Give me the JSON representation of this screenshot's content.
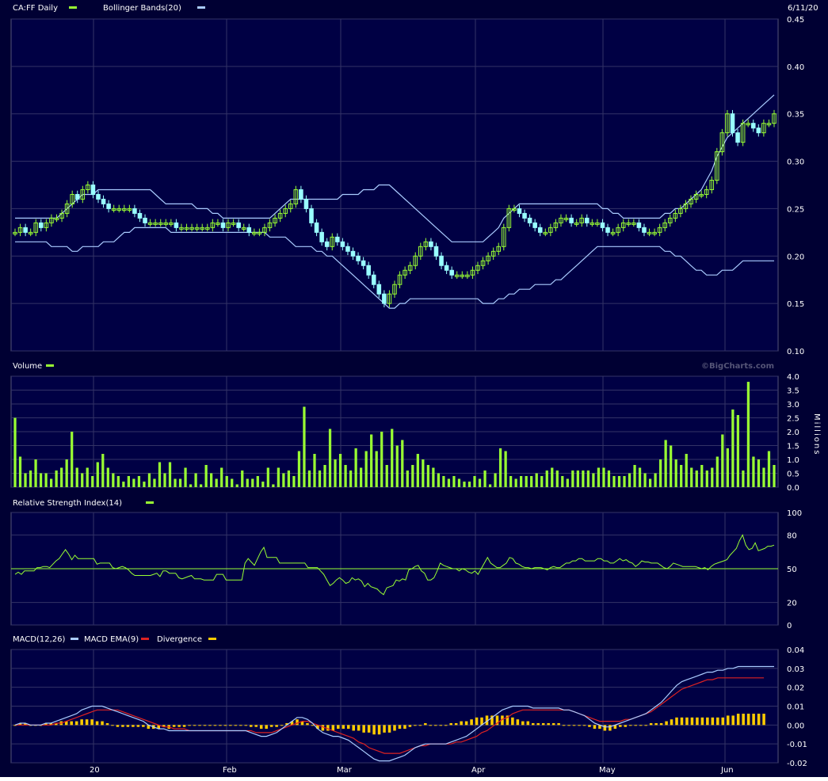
{
  "chart_data": [
    {
      "type": "candlestick",
      "title": "CA:FF Daily",
      "date_label": "6/11/20",
      "overlay_label": "Bollinger Bands(20)",
      "colors": {
        "up": "#99ff33",
        "down": "#99ffff",
        "upper_band": "#aaccff",
        "lower_band": "#aaccff"
      },
      "ylim": [
        0.1,
        0.45
      ],
      "y_ticks": [
        "0.45",
        "0.40",
        "0.35",
        "0.30",
        "0.25",
        "0.20",
        "0.15",
        "0.10"
      ],
      "x_ticks": [
        "20",
        "Feb",
        "Mar",
        "Apr",
        "May",
        "Jun"
      ],
      "close": [
        0.225,
        0.23,
        0.225,
        0.225,
        0.235,
        0.23,
        0.235,
        0.24,
        0.24,
        0.245,
        0.255,
        0.265,
        0.26,
        0.27,
        0.275,
        0.265,
        0.26,
        0.255,
        0.25,
        0.25,
        0.25,
        0.25,
        0.25,
        0.245,
        0.24,
        0.235,
        0.235,
        0.235,
        0.235,
        0.235,
        0.235,
        0.23,
        0.23,
        0.23,
        0.23,
        0.23,
        0.23,
        0.23,
        0.235,
        0.235,
        0.23,
        0.235,
        0.235,
        0.23,
        0.23,
        0.225,
        0.225,
        0.225,
        0.23,
        0.235,
        0.24,
        0.245,
        0.25,
        0.255,
        0.27,
        0.26,
        0.25,
        0.235,
        0.225,
        0.215,
        0.21,
        0.22,
        0.215,
        0.21,
        0.205,
        0.2,
        0.195,
        0.19,
        0.18,
        0.17,
        0.16,
        0.15,
        0.16,
        0.17,
        0.18,
        0.185,
        0.19,
        0.2,
        0.21,
        0.215,
        0.21,
        0.2,
        0.19,
        0.185,
        0.18,
        0.18,
        0.18,
        0.18,
        0.185,
        0.19,
        0.195,
        0.2,
        0.205,
        0.21,
        0.23,
        0.25,
        0.25,
        0.245,
        0.24,
        0.235,
        0.23,
        0.225,
        0.225,
        0.23,
        0.235,
        0.24,
        0.24,
        0.235,
        0.235,
        0.24,
        0.235,
        0.235,
        0.235,
        0.23,
        0.225,
        0.225,
        0.23,
        0.235,
        0.235,
        0.235,
        0.23,
        0.225,
        0.225,
        0.225,
        0.23,
        0.235,
        0.24,
        0.245,
        0.25,
        0.255,
        0.26,
        0.265,
        0.265,
        0.27,
        0.28,
        0.31,
        0.33,
        0.35,
        0.33,
        0.32,
        0.34,
        0.34,
        0.335,
        0.33,
        0.34,
        0.34,
        0.35
      ],
      "bollinger_upper": [
        0.24,
        0.24,
        0.24,
        0.24,
        0.24,
        0.24,
        0.24,
        0.24,
        0.24,
        0.245,
        0.25,
        0.255,
        0.26,
        0.265,
        0.265,
        0.265,
        0.27,
        0.27,
        0.27,
        0.27,
        0.27,
        0.27,
        0.27,
        0.27,
        0.27,
        0.27,
        0.27,
        0.265,
        0.26,
        0.255,
        0.255,
        0.255,
        0.255,
        0.255,
        0.255,
        0.25,
        0.25,
        0.25,
        0.245,
        0.245,
        0.24,
        0.24,
        0.24,
        0.24,
        0.24,
        0.24,
        0.24,
        0.24,
        0.24,
        0.24,
        0.245,
        0.25,
        0.255,
        0.26,
        0.26,
        0.26,
        0.26,
        0.26,
        0.26,
        0.26,
        0.26,
        0.26,
        0.26,
        0.265,
        0.265,
        0.265,
        0.265,
        0.27,
        0.27,
        0.27,
        0.275,
        0.275,
        0.275,
        0.27,
        0.265,
        0.26,
        0.255,
        0.25,
        0.245,
        0.24,
        0.235,
        0.23,
        0.225,
        0.22,
        0.215,
        0.215,
        0.215,
        0.215,
        0.215,
        0.215,
        0.215,
        0.22,
        0.225,
        0.23,
        0.24,
        0.245,
        0.25,
        0.255,
        0.255,
        0.255,
        0.255,
        0.255,
        0.255,
        0.255,
        0.255,
        0.255,
        0.255,
        0.255,
        0.255,
        0.255,
        0.255,
        0.255,
        0.255,
        0.25,
        0.25,
        0.245,
        0.245,
        0.24,
        0.24,
        0.24,
        0.24,
        0.24,
        0.24,
        0.24,
        0.24,
        0.245,
        0.245,
        0.25,
        0.25,
        0.255,
        0.26,
        0.265,
        0.27,
        0.28,
        0.29,
        0.305,
        0.315,
        0.325,
        0.33,
        0.335,
        0.34,
        0.345,
        0.35,
        0.355,
        0.36,
        0.365,
        0.37
      ],
      "bollinger_lower": [
        0.215,
        0.215,
        0.215,
        0.215,
        0.215,
        0.215,
        0.215,
        0.21,
        0.21,
        0.21,
        0.21,
        0.205,
        0.205,
        0.21,
        0.21,
        0.21,
        0.21,
        0.215,
        0.215,
        0.215,
        0.22,
        0.225,
        0.225,
        0.23,
        0.23,
        0.23,
        0.23,
        0.23,
        0.23,
        0.23,
        0.225,
        0.225,
        0.225,
        0.225,
        0.225,
        0.225,
        0.225,
        0.225,
        0.225,
        0.225,
        0.225,
        0.225,
        0.225,
        0.225,
        0.225,
        0.225,
        0.225,
        0.225,
        0.225,
        0.22,
        0.22,
        0.22,
        0.22,
        0.215,
        0.21,
        0.21,
        0.21,
        0.21,
        0.205,
        0.205,
        0.2,
        0.2,
        0.195,
        0.19,
        0.185,
        0.18,
        0.175,
        0.17,
        0.165,
        0.16,
        0.155,
        0.15,
        0.145,
        0.145,
        0.15,
        0.15,
        0.155,
        0.155,
        0.155,
        0.155,
        0.155,
        0.155,
        0.155,
        0.155,
        0.155,
        0.155,
        0.155,
        0.155,
        0.155,
        0.155,
        0.15,
        0.15,
        0.15,
        0.155,
        0.155,
        0.16,
        0.16,
        0.165,
        0.165,
        0.165,
        0.17,
        0.17,
        0.17,
        0.17,
        0.175,
        0.175,
        0.18,
        0.185,
        0.19,
        0.195,
        0.2,
        0.205,
        0.21,
        0.21,
        0.21,
        0.21,
        0.21,
        0.21,
        0.21,
        0.21,
        0.21,
        0.21,
        0.21,
        0.21,
        0.21,
        0.205,
        0.205,
        0.2,
        0.2,
        0.195,
        0.19,
        0.185,
        0.185,
        0.18,
        0.18,
        0.18,
        0.185,
        0.185,
        0.185,
        0.19,
        0.195,
        0.195,
        0.195,
        0.195,
        0.195,
        0.195,
        0.195
      ]
    },
    {
      "type": "bar",
      "title": "Volume",
      "ylabel": "Millions",
      "watermark": "©BigCharts.com",
      "color": "#99ff33",
      "ylim": [
        0,
        4.0
      ],
      "y_ticks": [
        "4.0",
        "3.5",
        "3.0",
        "2.5",
        "2.0",
        "1.5",
        "1.0",
        "0.5",
        "0.0"
      ],
      "values": [
        2.5,
        1.1,
        0.5,
        0.6,
        1.0,
        0.5,
        0.5,
        0.3,
        0.6,
        0.7,
        1.0,
        2.0,
        0.7,
        0.5,
        0.7,
        0.4,
        0.9,
        1.2,
        0.7,
        0.5,
        0.4,
        0.2,
        0.4,
        0.3,
        0.4,
        0.2,
        0.5,
        0.3,
        0.9,
        0.5,
        0.9,
        0.3,
        0.3,
        0.7,
        0.1,
        0.5,
        0.1,
        0.8,
        0.5,
        0.3,
        0.7,
        0.4,
        0.3,
        0.1,
        0.6,
        0.3,
        0.3,
        0.4,
        0.2,
        0.7,
        0.1,
        0.7,
        0.5,
        0.6,
        0.4,
        1.3,
        2.9,
        0.6,
        1.2,
        0.6,
        0.8,
        2.1,
        1.0,
        1.2,
        0.8,
        0.6,
        1.4,
        0.7,
        1.3,
        1.9,
        1.3,
        2.0,
        0.8,
        2.1,
        1.5,
        1.7,
        0.6,
        0.8,
        1.2,
        1.0,
        0.8,
        0.7,
        0.5,
        0.4,
        0.3,
        0.4,
        0.3,
        0.2,
        0.2,
        0.4,
        0.3,
        0.6,
        0.1,
        0.5,
        1.4,
        1.3,
        0.4,
        0.3,
        0.4,
        0.4,
        0.4,
        0.5,
        0.4,
        0.6,
        0.7,
        0.6,
        0.4,
        0.3,
        0.6,
        0.6,
        0.6,
        0.6,
        0.5,
        0.7,
        0.7,
        0.6,
        0.4,
        0.4,
        0.4,
        0.5,
        0.8,
        0.7,
        0.5,
        0.3,
        0.5,
        1.0,
        1.7,
        1.5,
        1.0,
        0.8,
        1.2,
        0.7,
        0.6,
        0.8,
        0.6,
        0.7,
        1.1,
        1.9,
        1.4,
        2.8,
        2.6,
        0.6,
        3.8,
        1.1,
        1.0,
        0.7,
        1.3,
        0.8
      ]
    },
    {
      "type": "line",
      "title": "Relative Strength Index(14)",
      "color": "#99ff33",
      "ylim": [
        0,
        100
      ],
      "y_ticks": [
        "100",
        "80",
        "50",
        "20",
        "0"
      ],
      "reference_line": 50,
      "values": [
        45,
        47,
        45,
        48,
        48,
        48,
        48,
        51,
        51,
        52,
        52,
        51,
        54,
        57,
        59,
        63,
        67,
        63,
        58,
        62,
        59,
        59,
        59,
        59,
        59,
        59,
        54,
        55,
        55,
        55,
        55,
        51,
        50,
        51,
        52,
        51,
        49,
        46,
        44,
        44,
        44,
        44,
        44,
        44,
        45,
        46,
        43,
        48,
        48,
        46,
        46,
        46,
        42,
        41,
        42,
        43,
        44,
        41,
        41,
        41,
        40,
        40,
        40,
        40,
        45,
        45,
        45,
        40,
        40,
        40,
        40,
        40,
        40,
        55,
        59,
        56,
        53,
        59,
        65,
        69,
        60,
        60,
        60,
        60,
        55,
        55,
        55,
        55,
        55,
        55,
        55,
        55,
        55,
        51,
        51,
        51,
        51,
        48,
        45,
        40,
        35,
        37,
        40,
        42,
        40,
        37,
        38,
        42,
        40,
        41,
        39,
        34,
        37,
        34,
        33,
        32,
        29,
        27,
        33,
        34,
        35,
        40,
        39,
        41,
        40,
        49,
        50,
        52,
        53,
        48,
        46,
        40,
        40,
        42,
        48,
        55,
        53,
        52,
        51,
        50,
        50,
        48,
        50,
        49,
        47,
        46,
        48,
        45,
        50,
        55,
        60,
        55,
        53,
        51,
        51,
        53,
        55,
        60,
        59,
        55,
        54,
        52,
        51,
        51,
        50,
        51,
        51,
        51,
        50,
        49,
        51,
        52,
        51,
        51,
        53,
        55,
        55,
        57,
        57,
        59,
        59,
        57,
        57,
        57,
        57,
        59,
        59,
        57,
        57,
        55,
        55,
        57,
        59,
        57,
        58,
        56,
        55,
        52,
        54,
        57,
        56,
        56,
        55,
        55,
        55,
        53,
        51,
        50,
        52,
        55,
        54,
        53,
        52,
        52,
        52,
        52,
        52,
        51,
        50,
        51,
        49,
        52,
        54,
        55,
        56,
        57,
        58,
        62,
        65,
        68,
        75,
        80,
        71,
        67,
        68,
        73,
        66,
        67,
        68,
        70,
        70,
        71
      ]
    },
    {
      "type": "line",
      "title": "MACD(12,26)",
      "ema_label": "MACD EMA(9)",
      "divergence_label": "Divergence",
      "colors": {
        "macd": "#aaccff",
        "ema": "#dd2222",
        "divergence": "#ffcc00"
      },
      "ylim": [
        -0.02,
        0.04
      ],
      "y_ticks": [
        "0.04",
        "0.03",
        "0.02",
        "0.01",
        "0.00",
        "-0.01",
        "-0.02"
      ],
      "macd": [
        0.0,
        0.001,
        0.001,
        0.0,
        0.0,
        0.0,
        0.001,
        0.001,
        0.002,
        0.003,
        0.004,
        0.005,
        0.006,
        0.008,
        0.009,
        0.01,
        0.01,
        0.01,
        0.009,
        0.008,
        0.007,
        0.006,
        0.005,
        0.004,
        0.003,
        0.002,
        0.0,
        -0.001,
        -0.002,
        -0.002,
        -0.003,
        -0.003,
        -0.003,
        -0.003,
        -0.003,
        -0.003,
        -0.003,
        -0.003,
        -0.003,
        -0.003,
        -0.003,
        -0.003,
        -0.003,
        -0.003,
        -0.003,
        -0.003,
        -0.004,
        -0.005,
        -0.006,
        -0.006,
        -0.005,
        -0.004,
        -0.002,
        0.0,
        0.002,
        0.004,
        0.004,
        0.003,
        0.001,
        -0.002,
        -0.004,
        -0.005,
        -0.006,
        -0.006,
        -0.007,
        -0.008,
        -0.01,
        -0.012,
        -0.014,
        -0.016,
        -0.018,
        -0.019,
        -0.019,
        -0.019,
        -0.018,
        -0.017,
        -0.016,
        -0.014,
        -0.012,
        -0.011,
        -0.01,
        -0.01,
        -0.01,
        -0.01,
        -0.01,
        -0.009,
        -0.008,
        -0.007,
        -0.006,
        -0.004,
        -0.002,
        0.0,
        0.002,
        0.004,
        0.006,
        0.008,
        0.009,
        0.01,
        0.01,
        0.01,
        0.01,
        0.009,
        0.009,
        0.009,
        0.009,
        0.009,
        0.009,
        0.008,
        0.008,
        0.007,
        0.006,
        0.005,
        0.003,
        0.001,
        0.0,
        -0.001,
        -0.001,
        0.0,
        0.001,
        0.002,
        0.003,
        0.004,
        0.005,
        0.006,
        0.008,
        0.01,
        0.012,
        0.015,
        0.018,
        0.021,
        0.023,
        0.024,
        0.025,
        0.026,
        0.027,
        0.028,
        0.028,
        0.029,
        0.029,
        0.03,
        0.03,
        0.031,
        0.031,
        0.031,
        0.031,
        0.031,
        0.031,
        0.031,
        0.031
      ],
      "ema": [
        0.0,
        0.0,
        0.0,
        0.0,
        0.0,
        0.0,
        0.0,
        0.0,
        0.001,
        0.001,
        0.002,
        0.003,
        0.004,
        0.005,
        0.006,
        0.007,
        0.008,
        0.008,
        0.008,
        0.008,
        0.008,
        0.007,
        0.006,
        0.005,
        0.004,
        0.003,
        0.002,
        0.001,
        0.0,
        -0.001,
        -0.001,
        -0.002,
        -0.002,
        -0.002,
        -0.003,
        -0.003,
        -0.003,
        -0.003,
        -0.003,
        -0.003,
        -0.003,
        -0.003,
        -0.003,
        -0.003,
        -0.003,
        -0.003,
        -0.003,
        -0.004,
        -0.004,
        -0.004,
        -0.004,
        -0.003,
        -0.002,
        -0.001,
        0.0,
        0.001,
        0.002,
        0.002,
        0.001,
        0.0,
        -0.001,
        -0.002,
        -0.003,
        -0.004,
        -0.005,
        -0.006,
        -0.007,
        -0.009,
        -0.01,
        -0.012,
        -0.013,
        -0.014,
        -0.015,
        -0.015,
        -0.015,
        -0.015,
        -0.014,
        -0.013,
        -0.012,
        -0.011,
        -0.011,
        -0.01,
        -0.01,
        -0.01,
        -0.01,
        -0.01,
        -0.009,
        -0.009,
        -0.008,
        -0.007,
        -0.006,
        -0.004,
        -0.003,
        -0.001,
        0.001,
        0.003,
        0.004,
        0.006,
        0.007,
        0.008,
        0.008,
        0.008,
        0.008,
        0.008,
        0.008,
        0.008,
        0.008,
        0.008,
        0.008,
        0.007,
        0.006,
        0.005,
        0.004,
        0.003,
        0.002,
        0.002,
        0.002,
        0.002,
        0.002,
        0.003,
        0.003,
        0.004,
        0.005,
        0.006,
        0.007,
        0.009,
        0.011,
        0.013,
        0.015,
        0.017,
        0.019,
        0.02,
        0.021,
        0.022,
        0.023,
        0.024,
        0.024,
        0.025,
        0.025,
        0.025,
        0.025,
        0.025,
        0.025,
        0.025,
        0.025,
        0.025,
        0.025
      ]
    }
  ]
}
